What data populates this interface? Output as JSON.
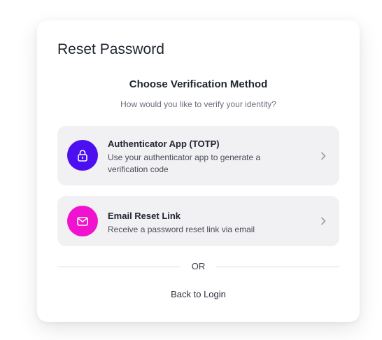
{
  "card": {
    "title": "Reset Password",
    "subtitle": "Choose Verification Method",
    "description": "How would you like to verify your identity?"
  },
  "options": [
    {
      "title": "Authenticator App (TOTP)",
      "text": "Use your authenticator app to generate a verification code",
      "icon": "lock-icon",
      "color": "#4b0ff0"
    },
    {
      "title": "Email Reset Link",
      "text": "Receive a password reset link via email",
      "icon": "mail-icon",
      "color": "#f012cf"
    }
  ],
  "divider_label": "OR",
  "back_label": "Back to Login"
}
